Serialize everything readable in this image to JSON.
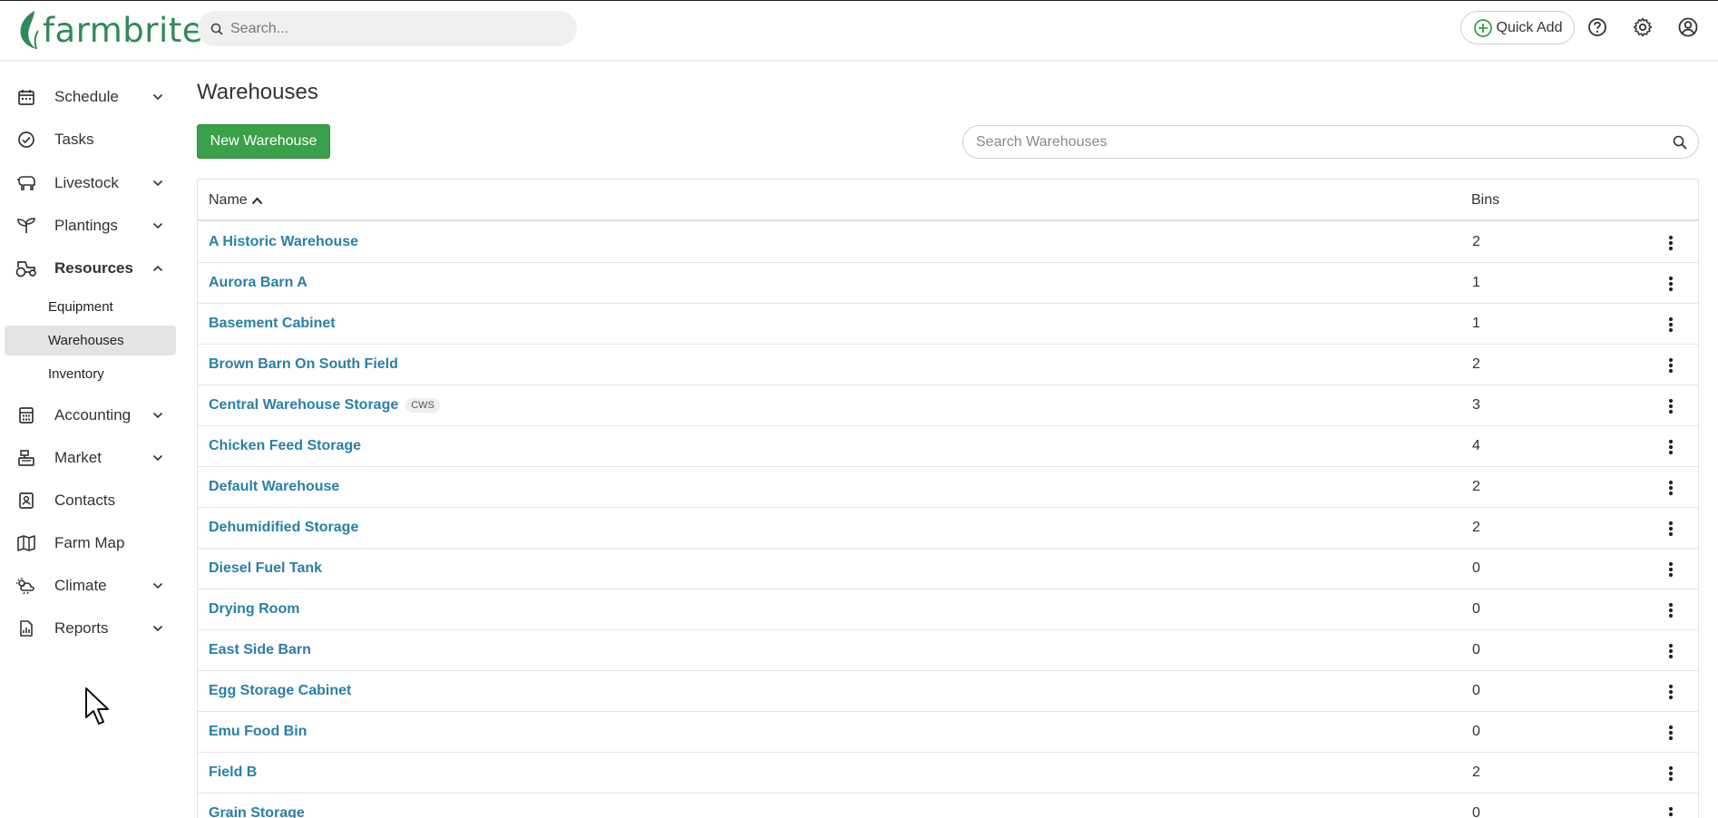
{
  "app": {
    "logo_text": "farmbrite",
    "brand_color": "#2e8b57",
    "accent_green": "#3ba04a",
    "link_color": "#2a7fa8"
  },
  "topbar": {
    "search_placeholder": "Search...",
    "quick_add_label": "Quick Add",
    "icons": [
      "help-icon",
      "settings-gear-icon",
      "user-account-icon"
    ]
  },
  "sidebar": {
    "items": [
      {
        "label": "Schedule",
        "icon": "calendar-icon",
        "has_chevron": true
      },
      {
        "label": "Tasks",
        "icon": "check-circle-icon",
        "has_chevron": false
      },
      {
        "label": "Livestock",
        "icon": "livestock-icon",
        "has_chevron": true
      },
      {
        "label": "Plantings",
        "icon": "sprout-icon",
        "has_chevron": true
      },
      {
        "label": "Resources",
        "icon": "tractor-icon",
        "has_chevron": true,
        "expanded": true
      },
      {
        "label": "Accounting",
        "icon": "calculator-icon",
        "has_chevron": true
      },
      {
        "label": "Market",
        "icon": "cash-register-icon",
        "has_chevron": true
      },
      {
        "label": "Contacts",
        "icon": "contact-card-icon",
        "has_chevron": false
      },
      {
        "label": "Farm Map",
        "icon": "map-icon",
        "has_chevron": false
      },
      {
        "label": "Climate",
        "icon": "weather-icon",
        "has_chevron": true
      },
      {
        "label": "Reports",
        "icon": "report-icon",
        "has_chevron": true
      }
    ],
    "resources_sub": [
      {
        "label": "Equipment",
        "active": false
      },
      {
        "label": "Warehouses",
        "active": true
      },
      {
        "label": "Inventory",
        "active": false
      }
    ]
  },
  "main": {
    "title": "Warehouses",
    "new_button": "New Warehouse",
    "search_placeholder": "Search Warehouses",
    "columns": {
      "name": "Name",
      "bins": "Bins"
    },
    "rows": [
      {
        "name": "A Historic Warehouse",
        "bins": "2",
        "badge": ""
      },
      {
        "name": "Aurora Barn A",
        "bins": "1",
        "badge": ""
      },
      {
        "name": "Basement Cabinet",
        "bins": "1",
        "badge": ""
      },
      {
        "name": "Brown Barn On South Field",
        "bins": "2",
        "badge": ""
      },
      {
        "name": "Central Warehouse Storage",
        "bins": "3",
        "badge": "CWS"
      },
      {
        "name": "Chicken Feed Storage",
        "bins": "4",
        "badge": ""
      },
      {
        "name": "Default Warehouse",
        "bins": "2",
        "badge": ""
      },
      {
        "name": "Dehumidified Storage",
        "bins": "2",
        "badge": ""
      },
      {
        "name": "Diesel Fuel Tank",
        "bins": "0",
        "badge": ""
      },
      {
        "name": "Drying Room",
        "bins": "0",
        "badge": ""
      },
      {
        "name": "East Side Barn",
        "bins": "0",
        "badge": ""
      },
      {
        "name": "Egg Storage Cabinet",
        "bins": "0",
        "badge": ""
      },
      {
        "name": "Emu Food Bin",
        "bins": "0",
        "badge": ""
      },
      {
        "name": "Field B",
        "bins": "2",
        "badge": ""
      },
      {
        "name": "Grain Storage",
        "bins": "0",
        "badge": ""
      }
    ]
  }
}
